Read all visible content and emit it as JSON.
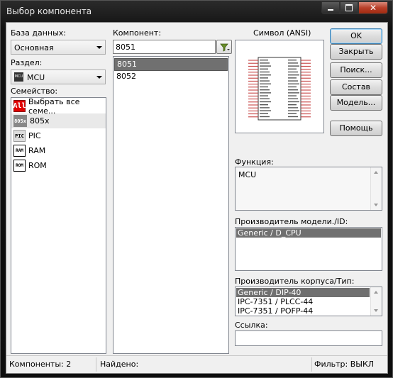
{
  "window": {
    "title": "Выбор компонента"
  },
  "database": {
    "label": "База данных:",
    "value": "Основная"
  },
  "section": {
    "label": "Раздел:",
    "value": "MCU"
  },
  "family": {
    "label": "Семейство:",
    "items": [
      {
        "label": "Выбрать все семе...",
        "icon": "all-icon",
        "icon_text": "All"
      },
      {
        "label": "805x",
        "icon": "chip-805x-icon",
        "icon_text": "805x"
      },
      {
        "label": "PIC",
        "icon": "chip-pic-icon",
        "icon_text": "PIC"
      },
      {
        "label": "RAM",
        "icon": "memory-ram-icon",
        "icon_text": "RAM"
      },
      {
        "label": "ROM",
        "icon": "memory-rom-icon",
        "icon_text": "ROM"
      }
    ]
  },
  "component": {
    "label": "Компонент:",
    "search_value": "8051",
    "items": [
      "8051",
      "8052"
    ]
  },
  "symbol": {
    "label": "Символ (ANSI)"
  },
  "buttons": {
    "ok": "OK",
    "close": "Закрыть",
    "search": "Поиск...",
    "composition": "Состав",
    "model": "Модель...",
    "help": "Помощь"
  },
  "function": {
    "label": "Функция:",
    "value": "MCU"
  },
  "model_mfr": {
    "label": "Производитель модели./ID:",
    "items": [
      "Generic / D_CPU"
    ]
  },
  "package_mfr": {
    "label": "Производитель корпуса/Тип:",
    "items": [
      "Generic / DIP-40",
      "IPC-7351 / PLCC-44",
      "IPC-7351 / POFP-44"
    ]
  },
  "link": {
    "label": "Ссылка:",
    "value": ""
  },
  "status": {
    "components": "Компоненты: 2",
    "found": "Найдено:",
    "filter": "Фильтр: ВЫКЛ"
  }
}
